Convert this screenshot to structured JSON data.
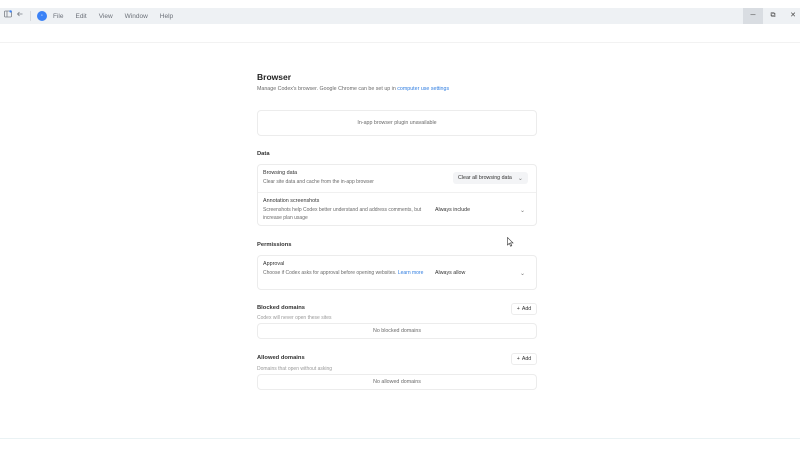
{
  "window": {
    "menu": [
      "File",
      "Edit",
      "View",
      "Window",
      "Help"
    ],
    "controls": {
      "minimize": "─",
      "restore": "⧉",
      "close": "✕"
    }
  },
  "icons": {
    "sidebar": "sidebar-toggle-icon",
    "back": "back-arrow-icon",
    "logo": "codex-logo-icon"
  },
  "page": {
    "title": "Browser",
    "subtitle_prefix": "Manage Codex's browser. Google Chrome can be set up in ",
    "subtitle_link": "computer use settings",
    "plugin_notice": "In-app browser plugin unavailable"
  },
  "data_section": {
    "label": "Data",
    "browsing_data": {
      "title": "Browsing data",
      "description": "Clear site data and cache from the in-app browser",
      "button": "Clear all browsing data"
    },
    "annotation": {
      "title": "Annotation screenshots",
      "description": "Screenshots help Codex better understand and address comments, but increase plan usage",
      "value": "Always include"
    }
  },
  "permissions": {
    "label": "Permissions",
    "approval": {
      "title": "Approval",
      "description": "Choose if Codex asks for approval before opening websites.",
      "link": "Learn more",
      "value": "Always allow"
    }
  },
  "blocked": {
    "label": "Blocked domains",
    "description": "Codex will never open these sites",
    "add": "Add",
    "empty": "No blocked domains"
  },
  "allowed": {
    "label": "Allowed domains",
    "description": "Domains that open without asking",
    "add": "Add",
    "empty": "No allowed domains"
  }
}
